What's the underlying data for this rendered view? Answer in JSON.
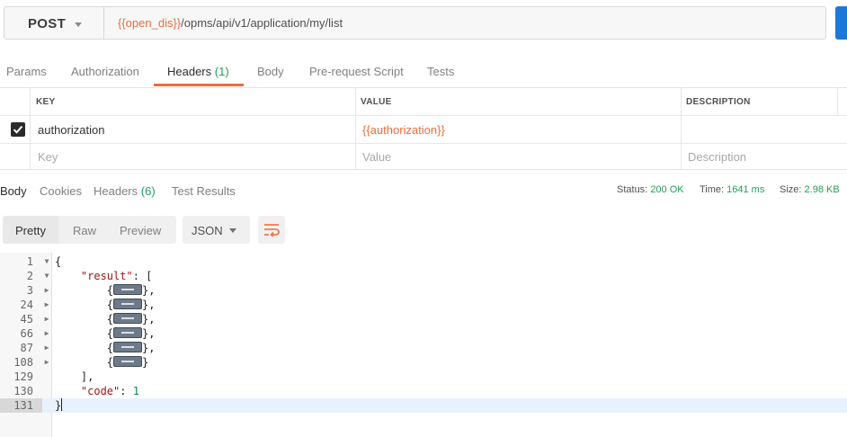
{
  "request": {
    "method": "POST",
    "url_var": "{{open_dis}}",
    "url_path": "/opms/api/v1/application/my/list"
  },
  "request_tabs": [
    {
      "label": "Params",
      "count": ""
    },
    {
      "label": "Authorization",
      "count": ""
    },
    {
      "label": "Headers",
      "count": "(1)"
    },
    {
      "label": "Body",
      "count": ""
    },
    {
      "label": "Pre-request Script",
      "count": ""
    },
    {
      "label": "Tests",
      "count": ""
    }
  ],
  "headers_table": {
    "columns": [
      "KEY",
      "VALUE",
      "DESCRIPTION"
    ],
    "rows": [
      {
        "checked": true,
        "key": "authorization",
        "value": "{{authorization}}",
        "description": ""
      }
    ],
    "placeholders": {
      "key": "Key",
      "value": "Value",
      "description": "Description"
    }
  },
  "response_tabs": [
    {
      "label": "Body",
      "count": ""
    },
    {
      "label": "Cookies",
      "count": ""
    },
    {
      "label": "Headers",
      "count": "(6)"
    },
    {
      "label": "Test Results",
      "count": ""
    }
  ],
  "response_meta": {
    "status_label": "Status:",
    "status_value": "200 OK",
    "time_label": "Time:",
    "time_value": "1641 ms",
    "size_label": "Size:",
    "size_value": "2.98 KB"
  },
  "body_toolbar": {
    "view_options": [
      "Pretty",
      "Raw",
      "Preview"
    ],
    "selected_view": "Pretty",
    "language": "JSON"
  },
  "code": {
    "line_numbers": [
      "1",
      "2",
      "3",
      "24",
      "45",
      "66",
      "87",
      "108",
      "129",
      "130",
      "131"
    ],
    "result_key": "\"result\"",
    "code_key": "\"code\"",
    "code_value": "1"
  },
  "colors": {
    "accent": "#f26b3a",
    "success": "#1f9e59",
    "send_button": "#1c78d8"
  }
}
